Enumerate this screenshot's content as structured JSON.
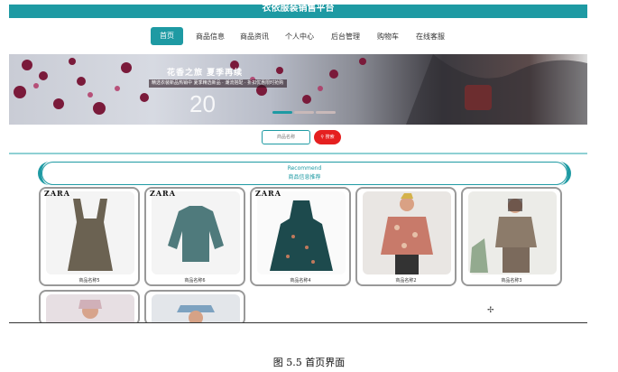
{
  "site_title": "衣依服装销售平台",
  "nav": [
    "首页",
    "商品信息",
    "商品资讯",
    "个人中心",
    "后台管理",
    "购物车",
    "在线客服"
  ],
  "banner": {
    "headline": "花香之旅 夏季再续",
    "subline": "精选衣装新品热销中 夏季精选新品 · 潮流搭配 · 折扣优惠限时抢购",
    "number": "20"
  },
  "search": {
    "placeholder": "商品名称",
    "button": "搜索"
  },
  "recommend": {
    "en": "Recommend",
    "cn": "商品信息推荐"
  },
  "products": [
    {
      "brand": "ZARA",
      "name": "商品名称5"
    },
    {
      "brand": "ZARA",
      "name": "商品名称6"
    },
    {
      "brand": "ZARA",
      "name": "商品名称4"
    },
    {
      "brand": "",
      "name": "商品名称2"
    },
    {
      "brand": "",
      "name": "商品名称3"
    },
    {
      "brand": "",
      "name": ""
    },
    {
      "brand": "",
      "name": ""
    }
  ],
  "caption": "图 5.5  首页界面",
  "colors": {
    "accent": "#1e9aa3",
    "search_button": "#e52020"
  }
}
